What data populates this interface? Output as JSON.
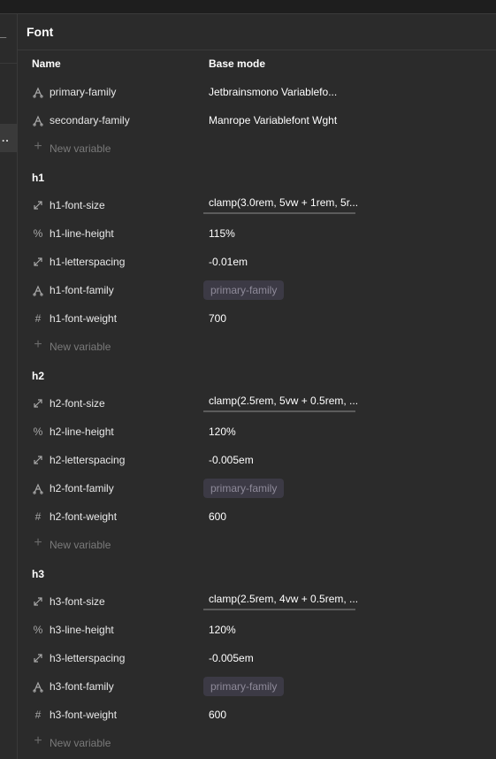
{
  "panel": {
    "title": "Font",
    "columns": {
      "name": "Name",
      "mode": "Base mode"
    },
    "new_variable_label": "New variable"
  },
  "left": {
    "selected_label": ".."
  },
  "globals": [
    {
      "icon": "font-family-icon",
      "name": "primary-family",
      "value": "Jetbrainsmono Variablefo..."
    },
    {
      "icon": "font-family-icon",
      "name": "secondary-family",
      "value": "Manrope Variablefont Wght"
    }
  ],
  "groups": [
    {
      "title": "h1",
      "rows": [
        {
          "icon": "size-icon",
          "name": "h1-font-size",
          "value": "clamp(3.0rem, 5vw + 1rem, 5r..."
        },
        {
          "icon": "percent-icon",
          "name": "h1-line-height",
          "value": "115%"
        },
        {
          "icon": "size-icon",
          "name": "h1-letterspacing",
          "value": "-0.01em"
        },
        {
          "icon": "font-family-icon",
          "name": "h1-font-family",
          "value": "primary-family"
        },
        {
          "icon": "number-icon",
          "name": "h1-font-weight",
          "value": "700"
        }
      ]
    },
    {
      "title": "h2",
      "rows": [
        {
          "icon": "size-icon",
          "name": "h2-font-size",
          "value": "clamp(2.5rem, 5vw + 0.5rem, ..."
        },
        {
          "icon": "percent-icon",
          "name": "h2-line-height",
          "value": "120%"
        },
        {
          "icon": "size-icon",
          "name": "h2-letterspacing",
          "value": "-0.005em"
        },
        {
          "icon": "font-family-icon",
          "name": "h2-font-family",
          "value": "primary-family"
        },
        {
          "icon": "number-icon",
          "name": "h2-font-weight",
          "value": "600"
        }
      ]
    },
    {
      "title": "h3",
      "rows": [
        {
          "icon": "size-icon",
          "name": "h3-font-size",
          "value": "clamp(2.5rem, 4vw + 0.5rem, ..."
        },
        {
          "icon": "percent-icon",
          "name": "h3-line-height",
          "value": "120%"
        },
        {
          "icon": "size-icon",
          "name": "h3-letterspacing",
          "value": "-0.005em"
        },
        {
          "icon": "font-family-icon",
          "name": "h3-font-family",
          "value": "primary-family"
        },
        {
          "icon": "number-icon",
          "name": "h3-font-weight",
          "value": "600"
        }
      ]
    }
  ]
}
